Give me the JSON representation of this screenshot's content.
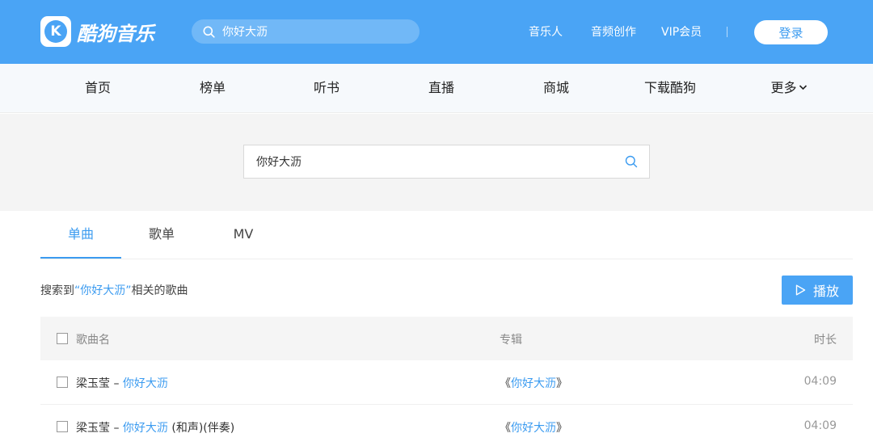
{
  "header": {
    "logo_letter": "K",
    "logo_text": "酷狗音乐",
    "search_value": "你好大沥",
    "links": [
      "音乐人",
      "音频创作",
      "VIP会员"
    ],
    "login_label": "登录"
  },
  "nav": {
    "items": [
      "首页",
      "榜单",
      "听书",
      "直播",
      "商城",
      "下载酷狗",
      "更多"
    ]
  },
  "search": {
    "value": "你好大沥"
  },
  "tabs": [
    "单曲",
    "歌单",
    "MV"
  ],
  "results": {
    "prefix": "搜索到",
    "keyword": "“你好大沥”",
    "suffix": "相关的歌曲",
    "play_label": "播放"
  },
  "table": {
    "headers": {
      "name": "歌曲名",
      "album": "专辑",
      "duration": "时长"
    },
    "rows": [
      {
        "artist": "梁玉莹",
        "dash": " – ",
        "title": "你好大沥",
        "extra": "",
        "album_open": "《",
        "album": "你好大沥",
        "album_close": "》",
        "duration": "04:09"
      },
      {
        "artist": "梁玉莹",
        "dash": " – ",
        "title": "你好大沥",
        "extra": " (和声)(伴奏)",
        "album_open": "《",
        "album": "你好大沥",
        "album_close": "》",
        "duration": "04:09"
      }
    ]
  },
  "colors": {
    "accent": "#3b9bf0",
    "header_bg": "#4aa4f5"
  }
}
